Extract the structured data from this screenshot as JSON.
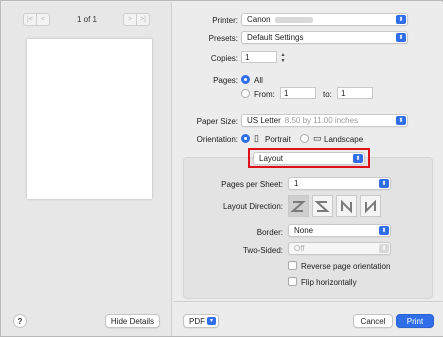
{
  "preview": {
    "page_count": "1 of 1",
    "prev_first_icon": "first-page",
    "prev_icon": "previous-page",
    "next_icon": "next-page",
    "next_last_icon": "last-page"
  },
  "footer_left": {
    "help_label": "?",
    "hide_details_label": "Hide Details"
  },
  "printer": {
    "label": "Printer:",
    "value": "Canon"
  },
  "presets": {
    "label": "Presets:",
    "value": "Default Settings"
  },
  "copies": {
    "label": "Copies:",
    "value": "1"
  },
  "pages": {
    "label": "Pages:",
    "all_label": "All",
    "from_label": "From:",
    "from_value": "1",
    "to_label": "to:",
    "to_value": "1"
  },
  "paper_size": {
    "label": "Paper Size:",
    "value": "US Letter",
    "detail": "8.50 by 11.00 inches"
  },
  "orientation": {
    "label": "Orientation:",
    "portrait_label": "Portrait",
    "landscape_label": "Landscape"
  },
  "section_popup": {
    "value": "Layout"
  },
  "layout": {
    "pages_per_sheet_label": "Pages per Sheet:",
    "pages_per_sheet_value": "1",
    "layout_direction_label": "Layout Direction:",
    "border_label": "Border:",
    "border_value": "None",
    "two_sided_label": "Two-Sided:",
    "two_sided_value": "Off",
    "reverse_label": "Reverse page orientation",
    "flip_label": "Flip horizontally"
  },
  "footer": {
    "pdf_label": "PDF",
    "cancel_label": "Cancel",
    "print_label": "Print"
  },
  "colors": {
    "accent": "#2f6ee8",
    "highlight": "#e0101a"
  }
}
